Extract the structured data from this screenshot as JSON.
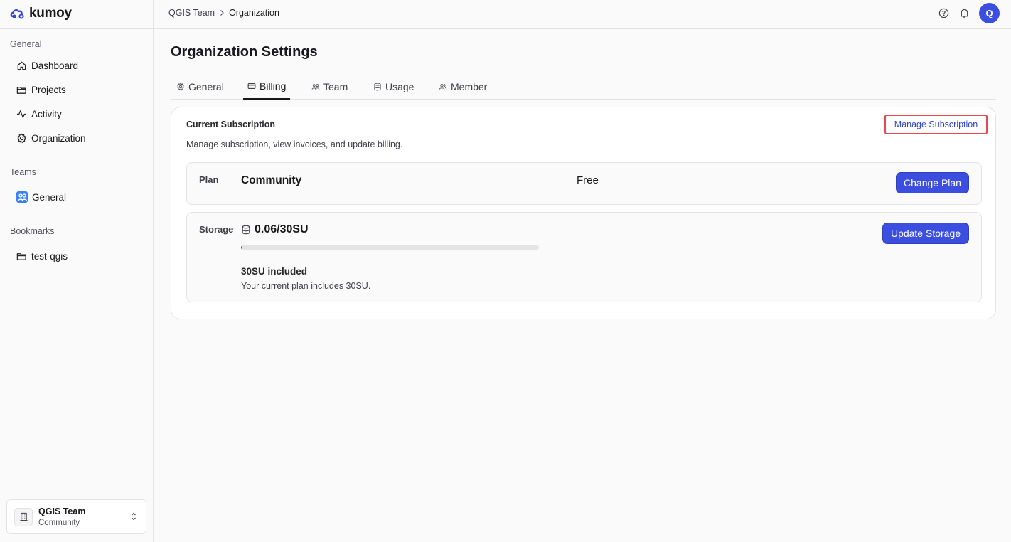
{
  "brand": {
    "name": "kumoy",
    "color": "#2f45d6"
  },
  "sidebar": {
    "general_heading": "General",
    "general_items": [
      {
        "label": "Dashboard",
        "icon": "home-icon"
      },
      {
        "label": "Projects",
        "icon": "folder-icon"
      },
      {
        "label": "Activity",
        "icon": "activity-icon"
      },
      {
        "label": "Organization",
        "icon": "gear-icon"
      }
    ],
    "teams_heading": "Teams",
    "teams": [
      {
        "label": "General",
        "icon": "team-icon"
      }
    ],
    "bookmarks_heading": "Bookmarks",
    "bookmarks": [
      {
        "label": "test-qgis",
        "icon": "folder-icon"
      }
    ],
    "team_switcher": {
      "name": "QGIS Team",
      "plan": "Community"
    }
  },
  "header": {
    "breadcrumb": [
      "QGIS Team",
      "Organization"
    ],
    "avatar_initial": "Q"
  },
  "main": {
    "title": "Organization Settings",
    "tabs": [
      {
        "label": "General",
        "active": false
      },
      {
        "label": "Billing",
        "active": true
      },
      {
        "label": "Team",
        "active": false
      },
      {
        "label": "Usage",
        "active": false
      },
      {
        "label": "Member",
        "active": false
      }
    ],
    "subscription": {
      "title": "Current Subscription",
      "description": "Manage subscription, view invoices, and update billing.",
      "manage_link": "Manage Subscription",
      "plan": {
        "label": "Plan",
        "name": "Community",
        "price": "Free",
        "button": "Change Plan"
      },
      "storage": {
        "label": "Storage",
        "value": "0.06/30SU",
        "used_fraction": 0.002,
        "included_title": "30SU included",
        "included_desc": "Your current plan includes 30SU.",
        "button": "Update Storage"
      }
    }
  },
  "colors": {
    "primary": "#3b4ee0",
    "highlight_border": "#e5484d"
  }
}
